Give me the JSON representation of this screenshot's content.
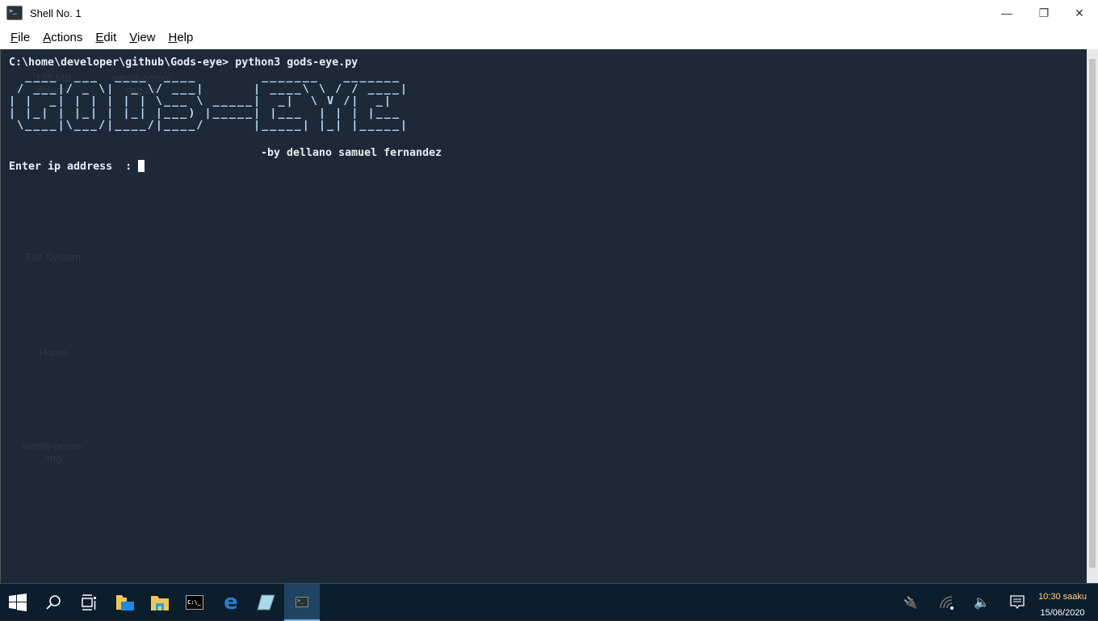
{
  "window": {
    "title": "Shell No. 1",
    "icon": "terminal-icon"
  },
  "menu": [
    "File",
    "Actions",
    "Edit",
    "View",
    "Help"
  ],
  "desktop_icons": [
    "128 MB Volume",
    "win98-qemu-img.zip",
    "File System",
    "Home",
    "win98-qemu-img"
  ],
  "terminal": {
    "command_line": "C:\\home\\developer\\github\\Gods-eye> python3 gods-eye.py",
    "banner": "  ____  ___  ____  ____        _______   _______ \n / ___|/ _ \\|  _ \\/ ___|      | ____\\ \\ / / ____|\n| |  _| | | | | | \\___ \\ _____|  _|  \\ V /|  _|  \n| |_| | |_| | |_| |___) |_____| |___  | | | |___ \n \\____|\\___/|____/|____/      |_____| |_| |_____|",
    "byline": "-by dellano samuel fernandez",
    "prompt": "Enter ip address  : "
  },
  "taskbar": {
    "items": [
      "start-icon",
      "search-icon",
      "task-view-icon",
      "file-explorer-user-icon",
      "file-explorer-icon",
      "cmd-icon",
      "edge-icon",
      "notepad-icon",
      "shell-icon"
    ],
    "tray": [
      "power-icon",
      "network-icon",
      "volume-icon",
      "notifications-icon"
    ],
    "time": "10:30 saaku",
    "date": "15/06/2020"
  },
  "colors": {
    "terminal_bg": "#1e2a38",
    "banner": "#bfe0ff",
    "taskbar": "#0c1d2c",
    "time": "#ffd27a"
  }
}
